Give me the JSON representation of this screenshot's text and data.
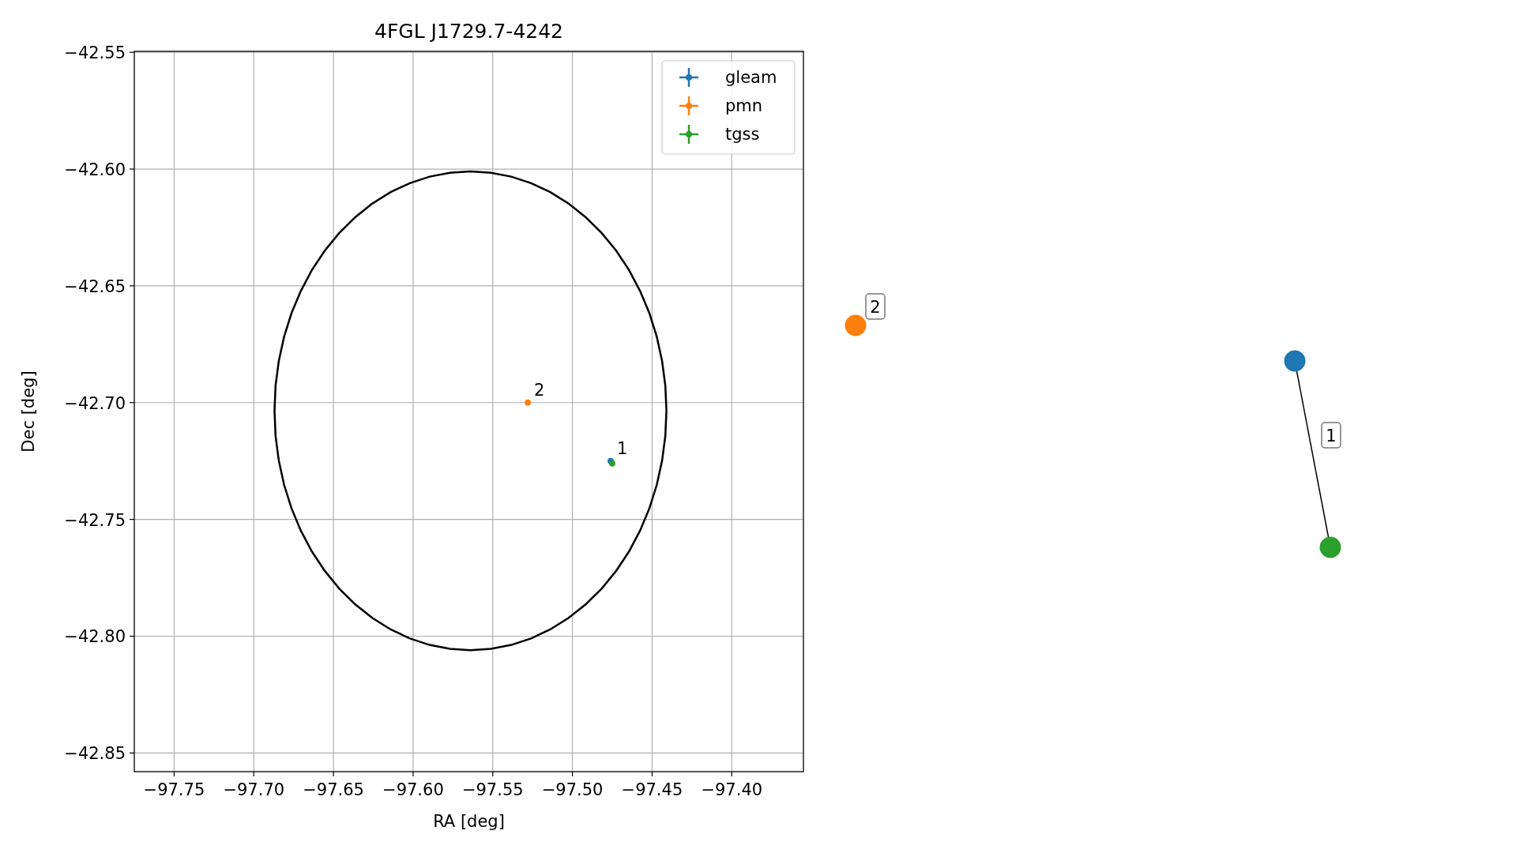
{
  "chart_data": {
    "type": "scatter",
    "title": "4FGL J1729.7-4242",
    "xlabel": "RA [deg]",
    "ylabel": "Dec [deg]",
    "xlim": [
      -97.775,
      -97.355
    ],
    "ylim": [
      -42.858,
      -42.5496
    ],
    "xticks": [
      {
        "value": -97.75,
        "label": "−97.75"
      },
      {
        "value": -97.7,
        "label": "−97.70"
      },
      {
        "value": -97.65,
        "label": "−97.65"
      },
      {
        "value": -97.6,
        "label": "−97.60"
      },
      {
        "value": -97.55,
        "label": "−97.55"
      },
      {
        "value": -97.5,
        "label": "−97.50"
      },
      {
        "value": -97.45,
        "label": "−97.45"
      },
      {
        "value": -97.4,
        "label": "−97.40"
      }
    ],
    "yticks": [
      {
        "value": -42.55,
        "label": "−42.55"
      },
      {
        "value": -42.6,
        "label": "−42.60"
      },
      {
        "value": -42.65,
        "label": "−42.65"
      },
      {
        "value": -42.7,
        "label": "−42.70"
      },
      {
        "value": -42.75,
        "label": "−42.75"
      },
      {
        "value": -42.8,
        "label": "−42.80"
      },
      {
        "value": -42.85,
        "label": "−42.85"
      }
    ],
    "x": [
      -97.528,
      -97.476,
      -97.475
    ],
    "series": [
      {
        "name": "gleam",
        "color": "#1f77b4",
        "values": [
          null,
          -42.725,
          null
        ]
      },
      {
        "name": "pmn",
        "color": "#ff7f0e",
        "values": [
          -42.7,
          null,
          null
        ]
      },
      {
        "name": "tgss",
        "color": "#2ca02c",
        "values": [
          null,
          null,
          -42.726
        ]
      }
    ],
    "annotations": [
      "2",
      "1"
    ],
    "grid": true,
    "legend": true
  },
  "match_graph": {
    "groups": [
      {
        "label": "2",
        "nodes": [
          {
            "color": "#ff7f0e"
          }
        ]
      },
      {
        "label": "1",
        "nodes": [
          {
            "color": "#1f77b4"
          },
          {
            "color": "#2ca02c"
          }
        ]
      }
    ]
  }
}
